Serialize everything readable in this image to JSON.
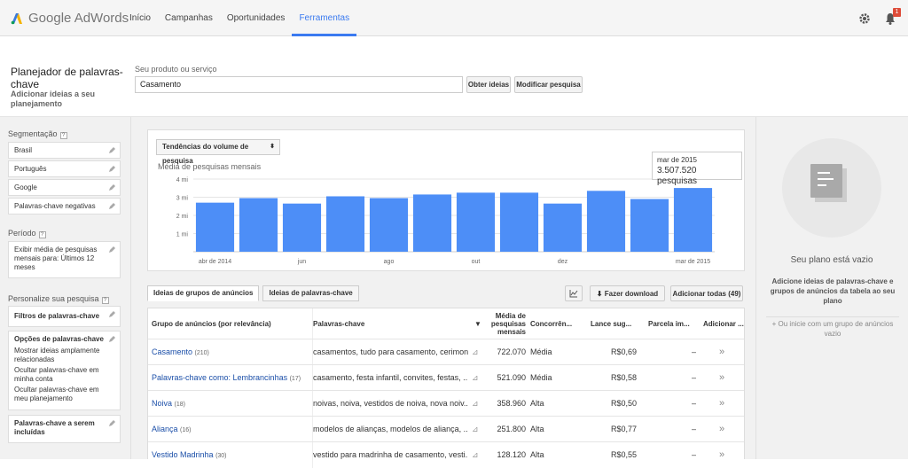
{
  "app": {
    "logo_text": "Google AdWords",
    "notification_count": "1"
  },
  "nav": {
    "items": [
      "Início",
      "Campanhas",
      "Oportunidades",
      "Ferramentas"
    ],
    "active": 3
  },
  "planner": {
    "title": "Planejador de palavras-chave",
    "subtitle": "Adicionar ideias a seu planejamento",
    "input_label": "Seu produto ou serviço",
    "input_value": "Casamento",
    "get_ideas": "Obter ideias",
    "modify": "Modificar pesquisa"
  },
  "left": {
    "segmentation_label": "Segmentação",
    "segments": [
      "Brasil",
      "Português",
      "Google",
      "Palavras-chave negativas"
    ],
    "period_label": "Período",
    "period_value": "Exibir média de pesquisas mensais para: Últimos 12 meses",
    "customize_label": "Personalize sua pesquisa",
    "filters": "Filtros de palavras-chave",
    "options_title": "Opções de palavras-chave",
    "options": [
      "Mostrar ideias amplamente relacionadas",
      "Ocultar palavras-chave em minha conta",
      "Ocultar palavras-chave em meu planejamento"
    ],
    "include": "Palavras-chave a serem incluídas"
  },
  "chart": {
    "selector": "Tendências do volume de pesquisa",
    "label": "Média de pesquisas mensais",
    "tooltip_month": "mar de 2015",
    "tooltip_value": "3.507.520 pesquisas"
  },
  "chart_data": {
    "type": "bar",
    "title": "",
    "ylabel": "Média de pesquisas mensais",
    "yticks": [
      "1 mi",
      "2 mi",
      "3 mi",
      "4 mi"
    ],
    "ylim": [
      0,
      4000000
    ],
    "categories": [
      "abr de 2014",
      "mai",
      "jun",
      "jul",
      "ago",
      "set",
      "out",
      "nov",
      "dez",
      "jan",
      "fev",
      "mar de 2015"
    ],
    "xlabels": [
      "abr de 2014",
      "jun",
      "ago",
      "out",
      "dez",
      "mar de 2015"
    ],
    "values": [
      2700000,
      2950000,
      2650000,
      3050000,
      2950000,
      3150000,
      3250000,
      3250000,
      2650000,
      3350000,
      2900000,
      3507520
    ]
  },
  "tabs": {
    "groups": "Ideias de grupos de anúncios",
    "keywords": "Ideias de palavras-chave",
    "download": "Fazer download",
    "add_all": "Adicionar todas (49)"
  },
  "table": {
    "headers": [
      "Grupo de anúncios (por relevância)",
      "Palavras-chave",
      "Média de pesquisas mensais",
      "Concorrên...",
      "Lance sug...",
      "Parcela im...",
      "Adicionar ..."
    ],
    "rows": [
      {
        "group": "Casamento",
        "count": "(210)",
        "keywords": "casamentos, tudo para casamento, cerimon...",
        "avg": "722.070",
        "comp": "Média",
        "bid": "R$0,69",
        "share": "–"
      },
      {
        "group": "Palavras-chave como: Lembrancinhas",
        "count": "(17)",
        "keywords": "casamento, festa infantil, convites, festas, ...",
        "avg": "521.090",
        "comp": "Média",
        "bid": "R$0,58",
        "share": "–"
      },
      {
        "group": "Noiva",
        "count": "(18)",
        "keywords": "noivas, noiva, vestidos de noiva, nova noiv...",
        "avg": "358.960",
        "comp": "Alta",
        "bid": "R$0,50",
        "share": "–"
      },
      {
        "group": "Aliança",
        "count": "(16)",
        "keywords": "modelos de alianças, modelos de aliança, ...",
        "avg": "251.800",
        "comp": "Alta",
        "bid": "R$0,77",
        "share": "–"
      },
      {
        "group": "Vestido Madrinha",
        "count": "(30)",
        "keywords": "vestido para madrinha de casamento, vesti...",
        "avg": "128.120",
        "comp": "Alta",
        "bid": "R$0,55",
        "share": "–"
      }
    ]
  },
  "right": {
    "empty": "Seu plano está vazio",
    "add_hint": "Adicione ideias de palavras-chave e grupos de anúncios da tabela ao seu plano",
    "or_hint": "+ Ou inicie com um grupo de anúncios vazio"
  }
}
